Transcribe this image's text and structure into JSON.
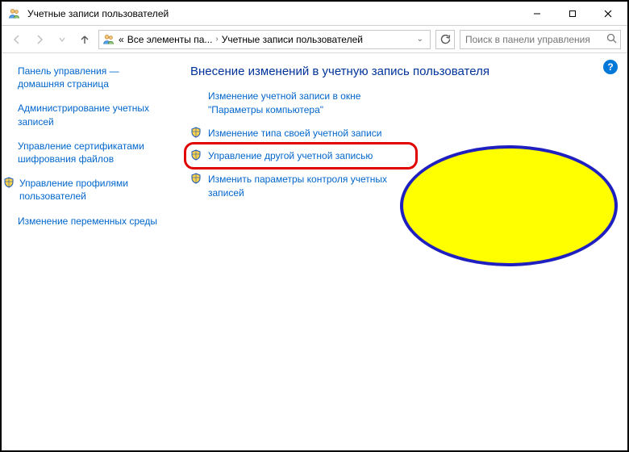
{
  "window": {
    "title": "Учетные записи пользователей"
  },
  "breadcrumb": {
    "root_left": "«",
    "item1": "Все элементы па...",
    "item2": "Учетные записи пользователей"
  },
  "search": {
    "placeholder": "Поиск в панели управления"
  },
  "sidebar": {
    "items": [
      {
        "label": "Панель управления — домашняя страница",
        "shield": false
      },
      {
        "label": "Администрирование учетных записей",
        "shield": false
      },
      {
        "label": "Управление сертификатами шифрования файлов",
        "shield": false
      },
      {
        "label": "Управление профилями пользователей",
        "shield": true
      },
      {
        "label": "Изменение переменных среды",
        "shield": false
      }
    ]
  },
  "main": {
    "heading": "Внесение изменений в учетную запись пользователя",
    "links": [
      {
        "label": "Изменение учетной записи в окне \"Параметры компьютера\"",
        "shield": false
      },
      {
        "label": "Изменение типа своей учетной записи",
        "shield": true
      },
      {
        "label": "Управление другой учетной записью",
        "shield": true
      },
      {
        "label": "Изменить параметры контроля учетных записей",
        "shield": true
      }
    ]
  },
  "help": {
    "glyph": "?"
  }
}
